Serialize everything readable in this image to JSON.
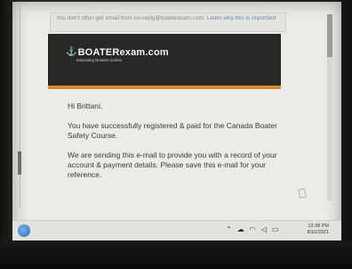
{
  "email": {
    "notice_text": "You don't often get email from no-reply@boaterexam.com.",
    "notice_link": "Learn why this is important",
    "logo_brand": "BOATERexam.com",
    "logo_tagline": "Educating Boaters Online",
    "greeting": "Hi Brittani,",
    "paragraph1": "You have successfully registered & paid for the Canada Boater Safety Course.",
    "paragraph2": "We are sending this e-mail to provide you with a record of your account & payment details. Please save this e-mail for your reference."
  },
  "taskbar": {
    "time": "12:38 PM",
    "date": "8/10/2021"
  },
  "icons": {
    "start": "windows-start-icon",
    "tray_up": "chevron-up-icon",
    "cloud": "cloud-icon",
    "wifi": "wifi-icon",
    "volume": "volume-icon",
    "battery": "battery-icon"
  },
  "colors": {
    "banner_bg": "#2a2826",
    "banner_accent": "#d9892b",
    "page_bg": "#ecebe6",
    "link": "#6b86b8"
  }
}
